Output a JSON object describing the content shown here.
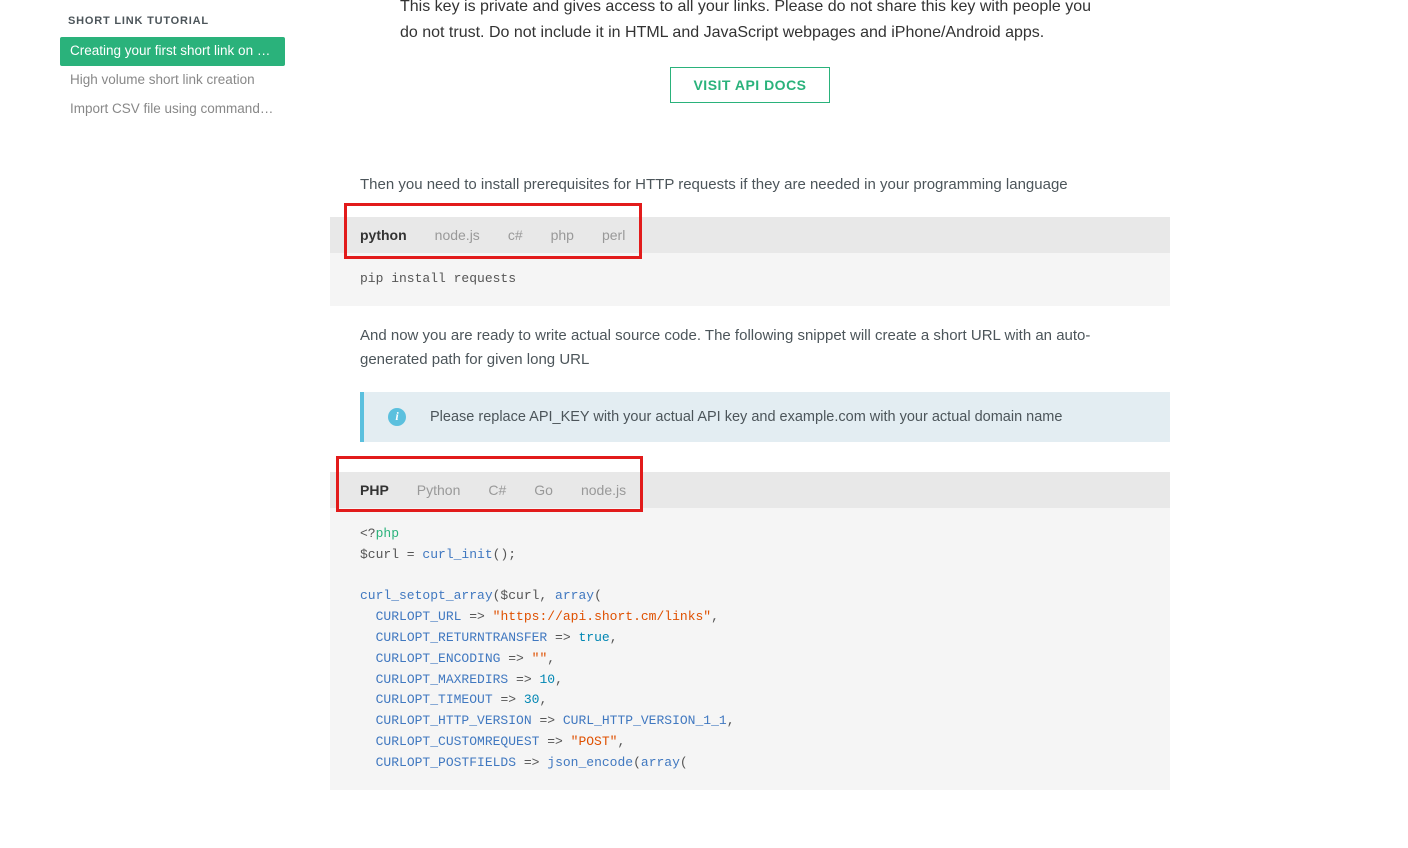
{
  "sidebar": {
    "title": "SHORT LINK TUTORIAL",
    "items": [
      {
        "label": "Creating your first short link on Sh…",
        "active": true
      },
      {
        "label": "High volume short link creation",
        "active": false
      },
      {
        "label": "Import CSV file using command lin…",
        "active": false
      }
    ]
  },
  "intro": "This key is private and gives access to all your links. Please do not share this key with people you do not trust. Do not include it in HTML and JavaScript webpages and iPhone/Android apps.",
  "api_button": "VISIT API DOCS",
  "para_prereq": "Then you need to install prerequisites for HTTP requests if they are needed in your programming language",
  "tabs1": {
    "items": [
      {
        "label": "python",
        "active": true
      },
      {
        "label": "node.js",
        "active": false
      },
      {
        "label": "c#",
        "active": false
      },
      {
        "label": "php",
        "active": false
      },
      {
        "label": "perl",
        "active": false
      }
    ],
    "code": "pip install requests"
  },
  "para_ready": "And now you are ready to write actual source code. The following snippet will create a short URL with an auto-generated path for given long URL",
  "callout": "Please replace API_KEY with your actual API key and example.com with your actual domain name",
  "tabs2": {
    "items": [
      {
        "label": "PHP",
        "active": true
      },
      {
        "label": "Python",
        "active": false
      },
      {
        "label": "C#",
        "active": false
      },
      {
        "label": "Go",
        "active": false
      },
      {
        "label": "node.js",
        "active": false
      }
    ]
  },
  "code2": {
    "open_tag": "<?",
    "php": "php",
    "l2a": "$curl = ",
    "l2b": "curl_init",
    "l2c": "();",
    "l4a": "curl_setopt_array",
    "l4b": "($curl, ",
    "l4c": "array",
    "l4d": "(",
    "opt_url": "CURLOPT_URL",
    "arrow": " => ",
    "str_url": "\"https://api.short.cm/links\"",
    "comma": ",",
    "opt_rt": "CURLOPT_RETURNTRANSFER",
    "true": "true",
    "opt_enc": "CURLOPT_ENCODING",
    "str_empty": "\"\"",
    "opt_max": "CURLOPT_MAXREDIRS",
    "num_10": "10",
    "opt_to": "CURLOPT_TIMEOUT",
    "num_30": "30",
    "opt_hv": "CURLOPT_HTTP_VERSION",
    "hv_const": "CURL_HTTP_VERSION_1_1",
    "opt_cr": "CURLOPT_CUSTOMREQUEST",
    "str_post": "\"POST\"",
    "opt_pf": "CURLOPT_POSTFIELDS",
    "json_enc": "json_encode",
    "paren_open": "(",
    "array2": "array",
    "paren_open2": "("
  }
}
